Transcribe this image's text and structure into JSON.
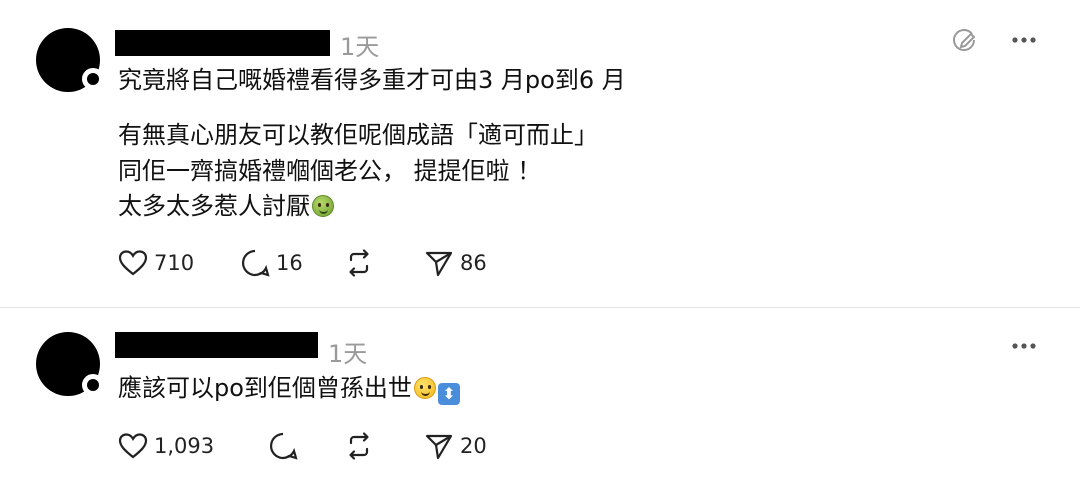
{
  "posts": [
    {
      "time": "1天",
      "lines": [
        "究竟將自己嘅婚禮看得多重才可由3 月po到6 月",
        "",
        "有無真心朋友可以教佢呢個成語「適可而止」",
        "同佢一齊搞婚禮嗰個老公， 提提佢啦 ！",
        "太多太多惹人討厭"
      ],
      "emoji": "nauseated-face-emoji",
      "likes": "710",
      "replies": "16",
      "reposts": "",
      "shares": "86"
    },
    {
      "time": "1天",
      "lines": [
        "應該可以po到佢個曾孫出世"
      ],
      "emoji": "slightly-smiling-face-emoji, up-down-arrow-emoji",
      "likes": "1,093",
      "replies": "",
      "reposts": "",
      "shares": "20"
    }
  ],
  "icons": {
    "like": "heart-icon",
    "reply": "comment-bubble-icon",
    "repost": "repost-arrows-icon",
    "share": "send-icon",
    "more": "more-dots-icon",
    "edit": "edit-circle-icon"
  },
  "colors": {
    "time": "#9a9a9a",
    "divider": "#e2e2e2",
    "redaction": "#000000"
  }
}
